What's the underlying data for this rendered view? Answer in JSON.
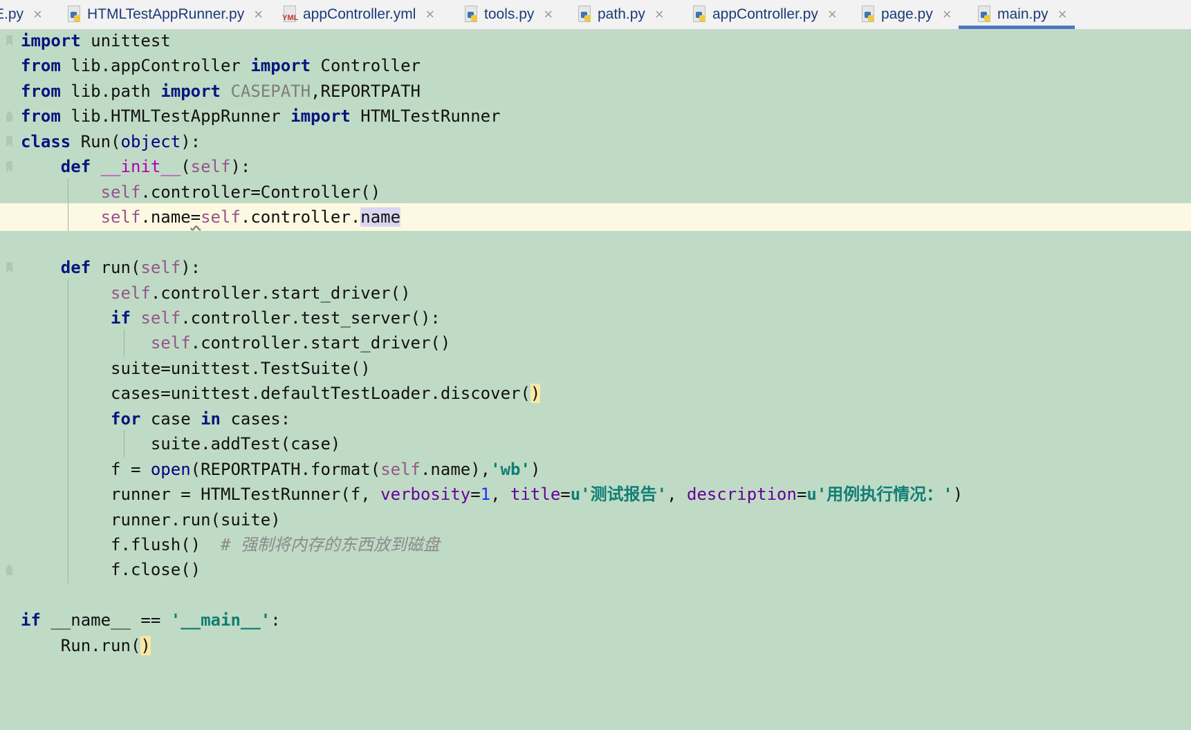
{
  "tabs": [
    {
      "label": "E.py",
      "icon": "python-file-icon",
      "active": false
    },
    {
      "label": "HTMLTestAppRunner.py",
      "icon": "python-file-icon",
      "active": false
    },
    {
      "label": "appController.yml",
      "icon": "yml-file-icon",
      "active": false
    },
    {
      "label": "tools.py",
      "icon": "python-file-icon",
      "active": false
    },
    {
      "label": "path.py",
      "icon": "python-file-icon",
      "active": false
    },
    {
      "label": "appController.py",
      "icon": "python-file-icon",
      "active": false
    },
    {
      "label": "page.py",
      "icon": "python-file-icon",
      "active": false
    },
    {
      "label": "main.py",
      "icon": "python-file-icon",
      "active": true
    }
  ],
  "icons": {
    "close": "×",
    "yml_text": "YML"
  },
  "colors": {
    "editor_bg": "#c0dbc5",
    "current_line": "#fdf8e1",
    "keyword": "#04157f",
    "self": "#94558d",
    "string": "#0f7f76",
    "comment": "#8a8a8a",
    "active_tab_underline": "#4a78c2"
  },
  "code": {
    "current_line_index": 7,
    "lines": [
      [
        {
          "t": "import",
          "c": "kw"
        },
        {
          "t": " unittest"
        }
      ],
      [
        {
          "t": "from",
          "c": "kw"
        },
        {
          "t": " lib.appController "
        },
        {
          "t": "import",
          "c": "kw"
        },
        {
          "t": " Controller"
        }
      ],
      [
        {
          "t": "from",
          "c": "kw"
        },
        {
          "t": " lib.path "
        },
        {
          "t": "import",
          "c": "kw"
        },
        {
          "t": " "
        },
        {
          "t": "CASEPATH",
          "c": "unused"
        },
        {
          "t": ",REPORTPATH"
        }
      ],
      [
        {
          "t": "from",
          "c": "kw"
        },
        {
          "t": " lib.HTMLTestAppRunner "
        },
        {
          "t": "import",
          "c": "kw"
        },
        {
          "t": " HTMLTestRunner"
        }
      ],
      [
        {
          "t": "class",
          "c": "kw"
        },
        {
          "t": " Run("
        },
        {
          "t": "object",
          "c": "builtin"
        },
        {
          "t": "):"
        }
      ],
      [
        {
          "t": "    "
        },
        {
          "t": "def",
          "c": "kw"
        },
        {
          "t": " "
        },
        {
          "t": "__init__",
          "c": "magic"
        },
        {
          "t": "("
        },
        {
          "t": "self",
          "c": "self"
        },
        {
          "t": "):"
        }
      ],
      [
        {
          "t": "        "
        },
        {
          "t": "self",
          "c": "self"
        },
        {
          "t": ".controller=Controller()"
        }
      ],
      [
        {
          "t": "        "
        },
        {
          "t": "self",
          "c": "self"
        },
        {
          "t": ".name"
        },
        {
          "t": "=",
          "c": "uline"
        },
        {
          "t": "self",
          "c": "self"
        },
        {
          "t": ".controller."
        },
        {
          "t": "name",
          "c": "hlid"
        }
      ],
      [],
      [
        {
          "t": "    "
        },
        {
          "t": "def",
          "c": "kw"
        },
        {
          "t": " run("
        },
        {
          "t": "self",
          "c": "self"
        },
        {
          "t": "):"
        }
      ],
      [
        {
          "t": "         "
        },
        {
          "t": "self",
          "c": "self"
        },
        {
          "t": ".controller.start_driver()"
        }
      ],
      [
        {
          "t": "         "
        },
        {
          "t": "if",
          "c": "kw"
        },
        {
          "t": " "
        },
        {
          "t": "self",
          "c": "self"
        },
        {
          "t": ".controller.test_server():"
        }
      ],
      [
        {
          "t": "             "
        },
        {
          "t": "self",
          "c": "self"
        },
        {
          "t": ".controller.start_driver()"
        }
      ],
      [
        {
          "t": "         suite=unittest.TestSuite()"
        }
      ],
      [
        {
          "t": "         cases=unittest.defaultTestLoader.discover("
        },
        {
          "t": ")",
          "c": "brace"
        }
      ],
      [
        {
          "t": "         "
        },
        {
          "t": "for",
          "c": "kw"
        },
        {
          "t": " case "
        },
        {
          "t": "in",
          "c": "kw"
        },
        {
          "t": " cases:"
        }
      ],
      [
        {
          "t": "             suite.addTest(case)"
        }
      ],
      [
        {
          "t": "         f = "
        },
        {
          "t": "open",
          "c": "builtin"
        },
        {
          "t": "(REPORTPATH.format("
        },
        {
          "t": "self",
          "c": "self"
        },
        {
          "t": ".name),"
        },
        {
          "t": "'wb'",
          "c": "str"
        },
        {
          "t": ")"
        }
      ],
      [
        {
          "t": "         runner = HTMLTestRunner(f, "
        },
        {
          "t": "verbosity",
          "c": "param"
        },
        {
          "t": "="
        },
        {
          "t": "1",
          "c": "num"
        },
        {
          "t": ", "
        },
        {
          "t": "title",
          "c": "param"
        },
        {
          "t": "="
        },
        {
          "t": "u'测试报告'",
          "c": "str"
        },
        {
          "t": ", "
        },
        {
          "t": "description",
          "c": "param"
        },
        {
          "t": "="
        },
        {
          "t": "u'用例执行情况：'",
          "c": "str"
        },
        {
          "t": ")"
        }
      ],
      [
        {
          "t": "         runner.run(suite)"
        }
      ],
      [
        {
          "t": "         f.flush()  "
        },
        {
          "t": "# 强制将内存的东西放到磁盘",
          "c": "cmt"
        }
      ],
      [
        {
          "t": "         f.close()"
        }
      ],
      [],
      [
        {
          "t": "if",
          "c": "kw"
        },
        {
          "t": " __name__ == "
        },
        {
          "t": "'__main__'",
          "c": "str"
        },
        {
          "t": ":"
        }
      ],
      [
        {
          "t": "    Run.run("
        },
        {
          "t": ")",
          "c": "brace"
        }
      ]
    ]
  }
}
